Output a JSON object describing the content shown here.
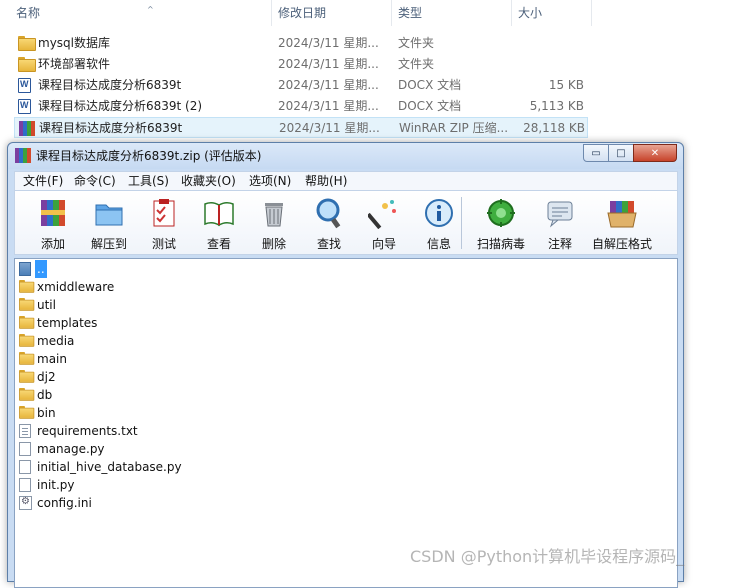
{
  "explorer": {
    "columns": {
      "name": "名称",
      "modified": "修改日期",
      "type": "类型",
      "size": "大小"
    },
    "rows": [
      {
        "name": "mysql数据库",
        "modified": "2024/3/11 星期...",
        "type": "文件夹",
        "size": "",
        "icon": "folder-icon"
      },
      {
        "name": "环境部署软件",
        "modified": "2024/3/11 星期...",
        "type": "文件夹",
        "size": "",
        "icon": "folder-icon"
      },
      {
        "name": "课程目标达成度分析6839t",
        "modified": "2024/3/11 星期...",
        "type": "DOCX 文档",
        "size": "15 KB",
        "icon": "docx-icon"
      },
      {
        "name": "课程目标达成度分析6839t (2)",
        "modified": "2024/3/11 星期...",
        "type": "DOCX 文档",
        "size": "5,113 KB",
        "icon": "docx-icon"
      },
      {
        "name": "课程目标达成度分析6839t",
        "modified": "2024/3/11 星期...",
        "type": "WinRAR ZIP 压缩...",
        "size": "28,118 KB",
        "icon": "winrar-archive-icon"
      }
    ]
  },
  "winrar": {
    "title": "课程目标达成度分析6839t.zip (评估版本)",
    "window_buttons": {
      "minimize": "▭",
      "maximize": "□",
      "close": "✕"
    },
    "menu": [
      "文件(F)",
      "命令(C)",
      "工具(S)",
      "收藏夹(O)",
      "选项(N)",
      "帮助(H)"
    ],
    "toolbar": [
      {
        "label": "添加",
        "icon": "add-archive-icon"
      },
      {
        "label": "解压到",
        "icon": "extract-folder-icon"
      },
      {
        "label": "测试",
        "icon": "test-checklist-icon"
      },
      {
        "label": "查看",
        "icon": "view-book-icon"
      },
      {
        "label": "删除",
        "icon": "trash-icon"
      },
      {
        "label": "查找",
        "icon": "search-icon"
      },
      {
        "label": "向导",
        "icon": "wizard-wand-icon"
      },
      {
        "label": "信息",
        "icon": "info-icon"
      },
      {
        "label": "扫描病毒",
        "icon": "virus-scan-icon"
      },
      {
        "label": "注释",
        "icon": "comment-icon"
      },
      {
        "label": "自解压格式",
        "icon": "sfx-box-icon"
      }
    ],
    "files": [
      {
        "name": "..",
        "icon": "up-folder-icon"
      },
      {
        "name": "xmiddleware",
        "icon": "folder-icon"
      },
      {
        "name": "util",
        "icon": "folder-icon"
      },
      {
        "name": "templates",
        "icon": "folder-icon"
      },
      {
        "name": "media",
        "icon": "folder-icon"
      },
      {
        "name": "main",
        "icon": "folder-icon"
      },
      {
        "name": "dj2",
        "icon": "folder-icon"
      },
      {
        "name": "db",
        "icon": "folder-icon"
      },
      {
        "name": "bin",
        "icon": "folder-icon"
      },
      {
        "name": "requirements.txt",
        "icon": "text-file-icon"
      },
      {
        "name": "manage.py",
        "icon": "file-icon"
      },
      {
        "name": "initial_hive_database.py",
        "icon": "file-icon"
      },
      {
        "name": "init.py",
        "icon": "file-icon"
      },
      {
        "name": "config.ini",
        "icon": "settings-file-icon"
      }
    ]
  },
  "watermark": "CSDN @Python计算机毕设程序源码_",
  "colors": {
    "selection": "#3399ff",
    "explorer_selected_row": "#e5f3fb",
    "window_frame": "#c9dcf3"
  }
}
